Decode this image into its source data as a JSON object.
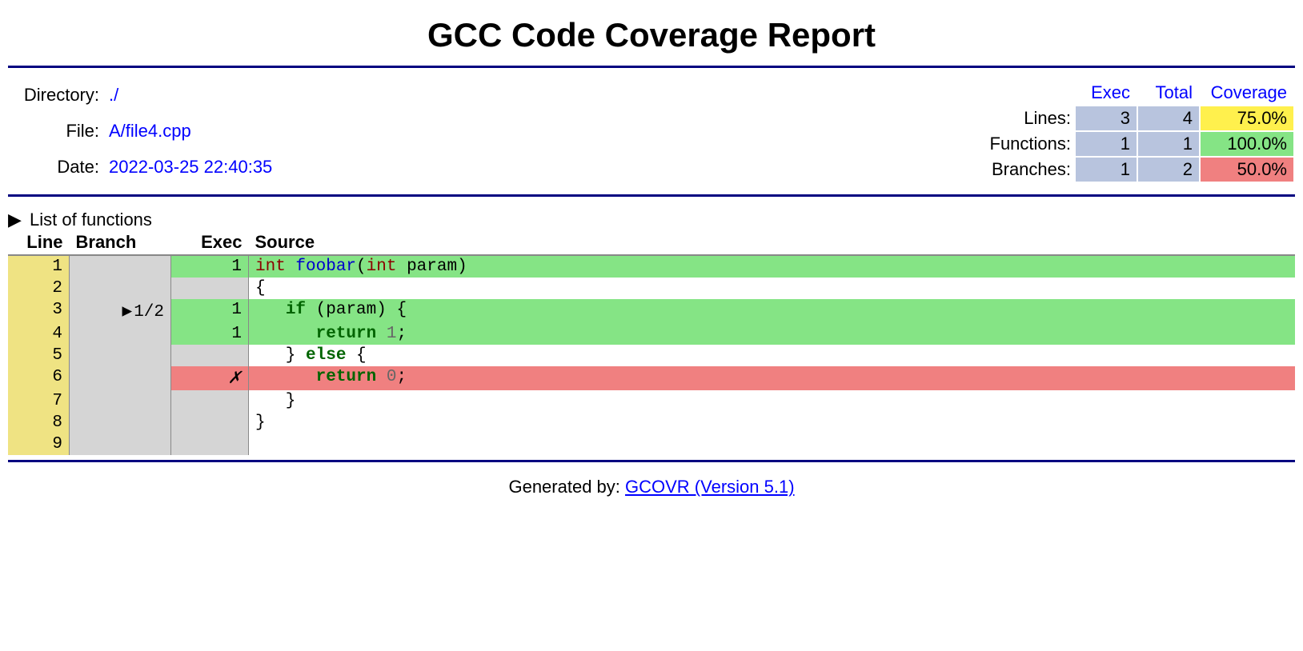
{
  "title": "GCC Code Coverage Report",
  "header": {
    "directory_label": "Directory:",
    "directory_value": "./",
    "file_label": "File:",
    "file_value": "A/file4.cpp",
    "date_label": "Date:",
    "date_value": "2022-03-25 22:40:35"
  },
  "stats": {
    "col_exec": "Exec",
    "col_total": "Total",
    "col_coverage": "Coverage",
    "lines_label": "Lines:",
    "lines_exec": "3",
    "lines_total": "4",
    "lines_cov": "75.0%",
    "functions_label": "Functions:",
    "functions_exec": "1",
    "functions_total": "1",
    "functions_cov": "100.0%",
    "branches_label": "Branches:",
    "branches_exec": "1",
    "branches_total": "2",
    "branches_cov": "50.0%"
  },
  "funclist_label": "List of functions",
  "columns": {
    "line": "Line",
    "branch": "Branch",
    "exec": "Exec",
    "source": "Source"
  },
  "source": {
    "r1": {
      "line": "1",
      "branch": "",
      "exec": "1"
    },
    "r2": {
      "line": "2",
      "branch": "",
      "exec": ""
    },
    "r3": {
      "line": "3",
      "branch": "1/2",
      "exec": "1"
    },
    "r4": {
      "line": "4",
      "branch": "",
      "exec": "1"
    },
    "r5": {
      "line": "5",
      "branch": "",
      "exec": ""
    },
    "r6": {
      "line": "6",
      "branch": "",
      "exec": "✗"
    },
    "r7": {
      "line": "7",
      "branch": "",
      "exec": ""
    },
    "r8": {
      "line": "8",
      "branch": "",
      "exec": ""
    },
    "r9": {
      "line": "9",
      "branch": "",
      "exec": ""
    }
  },
  "code": {
    "int": "int",
    "foobar": "foobar",
    "param": " param)",
    "open_paren": "(",
    "open_brace": "{",
    "if": "if",
    "if_cond_open": " (param) {",
    "return": "return",
    "one": " 1",
    "zero": " 0",
    "semi": ";",
    "else_line_open": "   } ",
    "else": "else",
    "else_line_close": " {",
    "close_brace": "   }",
    "close_brace2": "}",
    "indent2": "   ",
    "indent4": "      "
  },
  "footer": {
    "prefix": "Generated by: ",
    "link": "GCOVR (Version 5.1)"
  }
}
